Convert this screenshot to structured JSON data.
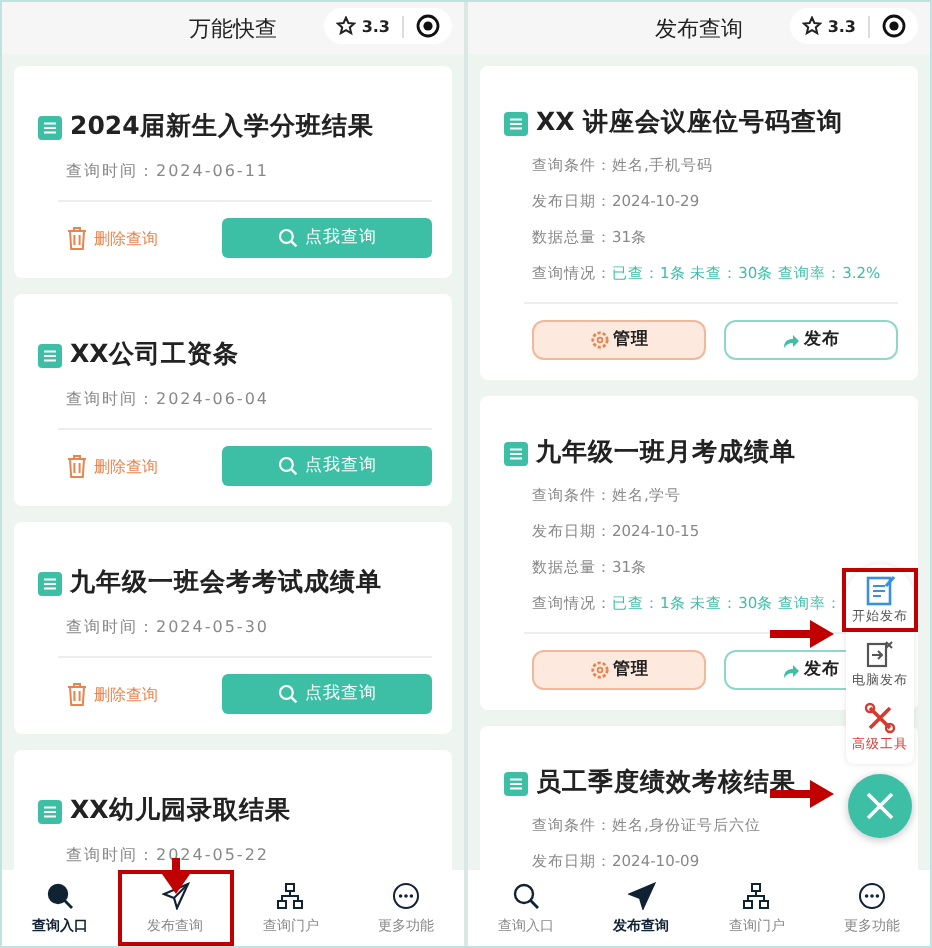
{
  "screens": [
    {
      "title": "万能快查",
      "rating": "3.3",
      "kind": "list",
      "cards": [
        {
          "title": "2024届新生入学分班结果",
          "time": "查询时间：2024-06-11",
          "delete": "删除查询",
          "query": "点我查询"
        },
        {
          "title": "XX公司工资条",
          "time": "查询时间：2024-06-04",
          "delete": "删除查询",
          "query": "点我查询"
        },
        {
          "title": "九年级一班会考考试成绩单",
          "time": "查询时间：2024-05-30",
          "delete": "删除查询",
          "query": "点我查询"
        },
        {
          "title": "XX幼儿园录取结果",
          "time": "查询时间：2024-05-22"
        }
      ],
      "nav": [
        {
          "label": "查询入口",
          "selected": true,
          "highlighted": false
        },
        {
          "label": "发布查询",
          "selected": false,
          "highlighted": true
        },
        {
          "label": "查询门户",
          "selected": false,
          "highlighted": false
        },
        {
          "label": "更多功能",
          "selected": false,
          "highlighted": false
        }
      ]
    },
    {
      "title": "发布查询",
      "rating": "3.3",
      "kind": "publish",
      "cards": [
        {
          "title": "XX 讲座会议座位号码查询",
          "fields": [
            "查询条件：姓名,手机号码",
            "发布日期：2024-10-29",
            "数据总量：31条"
          ],
          "status_label": "查询情况：",
          "status_value": "已查：1条 未查：30条 查询率：3.2%",
          "manage": "管理",
          "publish": "发布"
        },
        {
          "title": "九年级一班月考成绩单",
          "fields": [
            "查询条件：姓名,学号",
            "发布日期：2024-10-15",
            "数据总量：31条"
          ],
          "status_label": "查询情况：",
          "status_value": "已查：1条 未查：30条 查询率：",
          "manage": "管理",
          "publish": "发布"
        },
        {
          "title": "员工季度绩效考核结果",
          "fields": [
            "查询条件：姓名,身份证号后六位",
            "发布日期：2024-10-09"
          ]
        }
      ],
      "menu": [
        {
          "label": "开始发布",
          "kind": "doc",
          "highlighted": true
        },
        {
          "label": "电脑发布",
          "kind": "pc",
          "highlighted": false
        },
        {
          "label": "高级工具",
          "kind": "tools",
          "highlighted": false
        }
      ],
      "nav": [
        {
          "label": "查询入口",
          "selected": false,
          "highlighted": false
        },
        {
          "label": "发布查询",
          "selected": true,
          "highlighted": false
        },
        {
          "label": "查询门户",
          "selected": false,
          "highlighted": false
        },
        {
          "label": "更多功能",
          "selected": false,
          "highlighted": false
        }
      ]
    }
  ]
}
